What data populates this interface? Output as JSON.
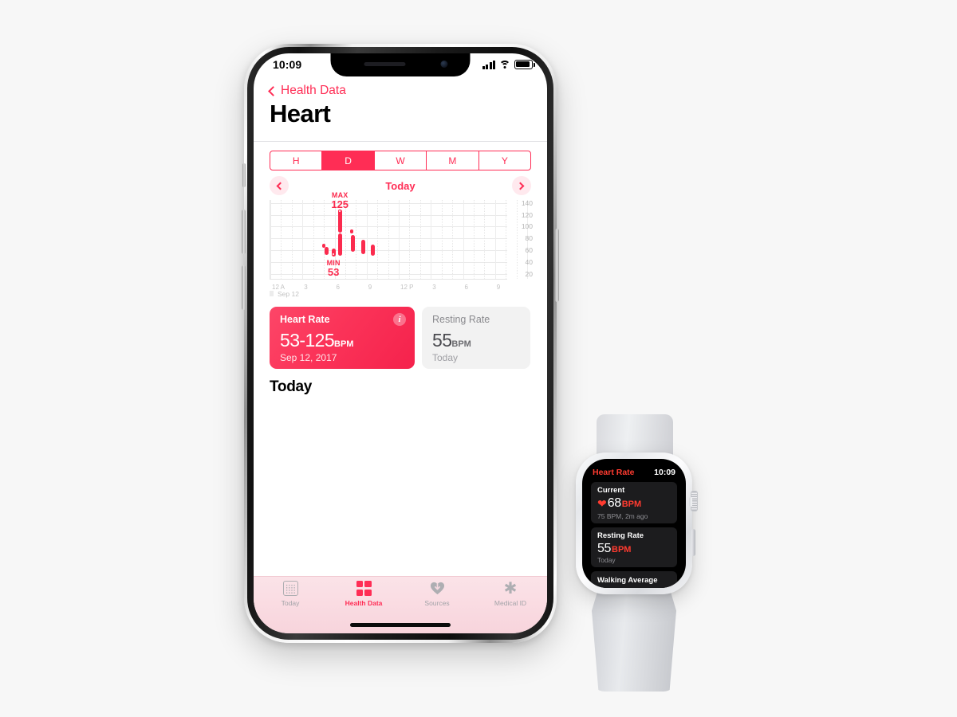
{
  "phone": {
    "status_bar": {
      "time": "10:09",
      "signal_icon": "cellular-bars-icon",
      "wifi_icon": "wifi-icon",
      "battery_icon": "battery-icon"
    },
    "nav": {
      "back_label": "Health Data",
      "back_icon": "chevron-left-icon",
      "title": "Heart"
    },
    "segmented": {
      "options": [
        "H",
        "D",
        "W",
        "M",
        "Y"
      ],
      "selected": "D"
    },
    "date_nav": {
      "prev_icon": "chevron-left-icon",
      "label": "Today",
      "next_icon": "chevron-right-icon"
    },
    "cards": {
      "heart_rate": {
        "title": "Heart Rate",
        "value": "53-125",
        "unit": "BPM",
        "sub": "Sep 12, 2017",
        "info_icon": "info-icon",
        "accent": "#fb2b4e"
      },
      "resting_rate": {
        "title": "Resting Rate",
        "value": "55",
        "unit": "BPM",
        "sub": "Today"
      }
    },
    "today_heading": "Today",
    "tabs": [
      {
        "label": "Today",
        "icon": "calendar-icon",
        "selected": false
      },
      {
        "label": "Health Data",
        "icon": "grid-icon",
        "selected": true
      },
      {
        "label": "Sources",
        "icon": "heart-download-icon",
        "selected": false
      },
      {
        "label": "Medical ID",
        "icon": "asterisk-icon",
        "selected": false
      }
    ]
  },
  "chart_data": {
    "type": "bar",
    "title": "Heart Rate",
    "xlabel": "",
    "ylabel": "BPM",
    "ylim": [
      20,
      140
    ],
    "ytick_labels": [
      "140",
      "120",
      "100",
      "80",
      "60",
      "40",
      "20"
    ],
    "yticks": [
      140,
      120,
      100,
      80,
      60,
      40,
      20
    ],
    "xtick_labels": [
      "12 A",
      "3",
      "6",
      "9",
      "12 P",
      "3",
      "6",
      "9"
    ],
    "xticks_hours": [
      0,
      3,
      6,
      9,
      12,
      15,
      18,
      21
    ],
    "date_label": "Sep 12",
    "grid": true,
    "max": {
      "label": "MAX",
      "value": "125"
    },
    "min": {
      "label": "MIN",
      "value": "53"
    },
    "bar_color": "#fb2b4e",
    "bars": [
      {
        "hour": 5.0,
        "low": 67,
        "high": 67
      },
      {
        "hour": 5.25,
        "low": 55,
        "high": 62
      },
      {
        "hour": 5.9,
        "low": 53,
        "high": 60
      },
      {
        "hour": 6.5,
        "low": 122,
        "high": 125
      },
      {
        "hour": 6.5,
        "low": 93,
        "high": 122
      },
      {
        "hour": 6.55,
        "low": 54,
        "high": 85
      },
      {
        "hour": 7.6,
        "low": 92,
        "high": 92
      },
      {
        "hour": 7.7,
        "low": 61,
        "high": 82
      },
      {
        "hour": 8.7,
        "low": 56,
        "high": 74
      },
      {
        "hour": 9.6,
        "low": 54,
        "high": 66
      }
    ]
  },
  "watch": {
    "app_title": "Heart Rate",
    "time": "10:09",
    "accent": "#ff3b30",
    "cards": [
      {
        "title": "Current",
        "heart_icon": "heart-icon",
        "value": "68",
        "unit": "BPM",
        "sub": "75 BPM, 2m ago"
      },
      {
        "title": "Resting Rate",
        "value": "55",
        "unit": "BPM",
        "sub": "Today"
      },
      {
        "title": "Walking Average"
      }
    ]
  }
}
